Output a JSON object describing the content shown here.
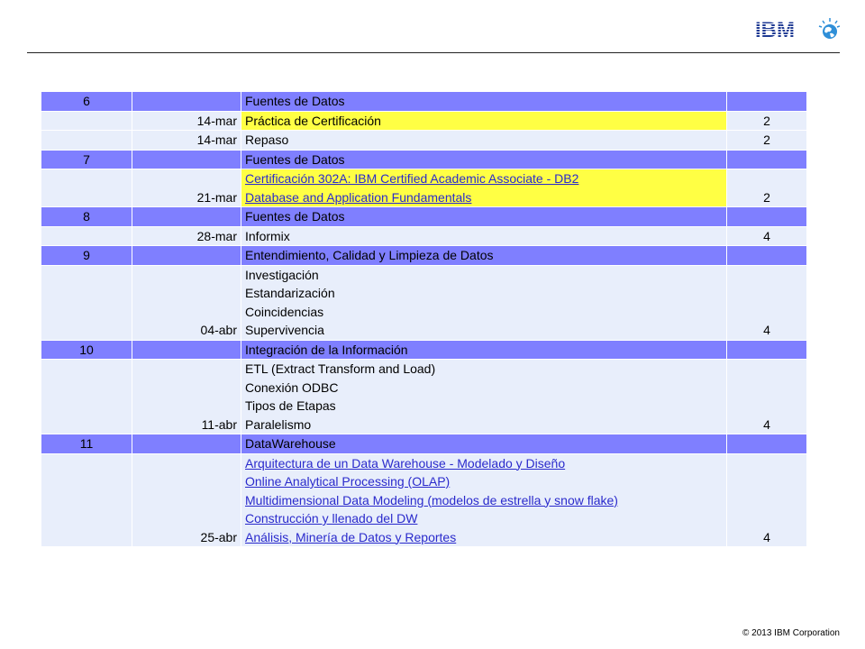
{
  "footer": "© 2013 IBM Corporation",
  "logo_text": "IBM",
  "rows": [
    {
      "kind": "hdr",
      "week": "6",
      "topic": "Fuentes de Datos"
    },
    {
      "kind": "body",
      "date": "14-mar",
      "items": [
        "Práctica de Certificación"
      ],
      "hours": "2",
      "highlight": true,
      "link": false
    },
    {
      "kind": "body",
      "date": "14-mar",
      "items": [
        "Repaso"
      ],
      "hours": "2",
      "highlight": false,
      "link": false
    },
    {
      "kind": "hdr",
      "week": "7",
      "topic": "Fuentes de Datos"
    },
    {
      "kind": "body",
      "date": "21-mar",
      "items": [
        "Certificación 302A: IBM Certified Academic Associate - DB2",
        "Database and Application Fundamentals"
      ],
      "hours": "2",
      "highlight": true,
      "link": true
    },
    {
      "kind": "hdr",
      "week": "8",
      "topic": "Fuentes de Datos"
    },
    {
      "kind": "body",
      "date": "28-mar",
      "items": [
        "Informix"
      ],
      "hours": "4",
      "highlight": false,
      "link": false
    },
    {
      "kind": "hdr",
      "week": "9",
      "topic": "Entendimiento, Calidad y Limpieza de Datos"
    },
    {
      "kind": "body",
      "date": "04-abr",
      "items": [
        "Investigación",
        "Estandarización",
        "Coincidencias",
        "Supervivencia"
      ],
      "hours": "4",
      "highlight": false,
      "link": false
    },
    {
      "kind": "hdr",
      "week": "10",
      "topic": "Integración de la Información"
    },
    {
      "kind": "body",
      "date": "11-abr",
      "items": [
        "ETL (Extract Transform and Load)",
        "Conexión ODBC",
        "Tipos de Etapas",
        "Paralelismo"
      ],
      "hours": "4",
      "highlight": false,
      "link": false
    },
    {
      "kind": "hdr",
      "week": "11",
      "topic": "DataWarehouse"
    },
    {
      "kind": "body",
      "date": "25-abr",
      "items": [
        "Arquitectura de un Data Warehouse - Modelado y Diseño",
        "Online Analytical Processing (OLAP)",
        "Multidimensional Data Modeling (modelos de estrella y snow flake)",
        "Construcción y llenado del DW",
        "Análisis, Minería de Datos y Reportes"
      ],
      "hours": "4",
      "highlight": false,
      "link": true
    }
  ]
}
